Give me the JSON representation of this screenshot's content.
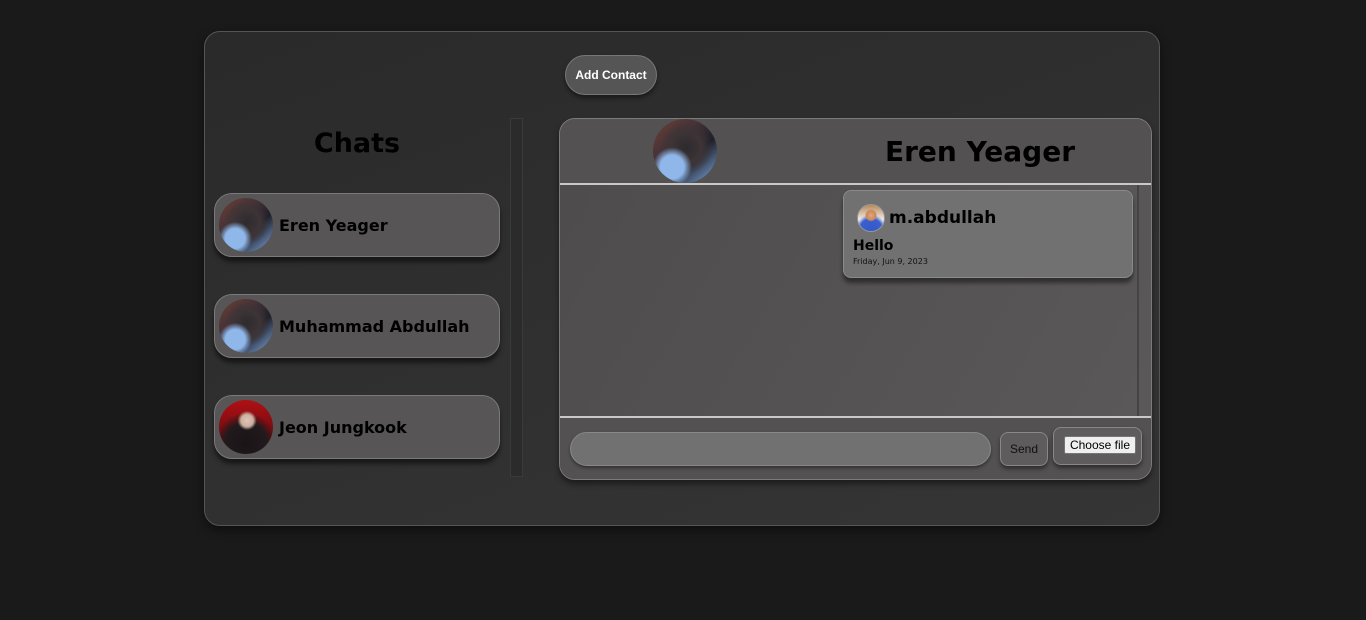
{
  "toolbar": {
    "add_contact_label": "Add Contact"
  },
  "sidebar": {
    "title": "Chats",
    "chats": [
      {
        "name": "Eren Yeager",
        "avatar": "eren-avatar"
      },
      {
        "name": "Muhammad Abdullah",
        "avatar": "eren-avatar"
      },
      {
        "name": "Jeon Jungkook",
        "avatar": "jungkook-avatar"
      }
    ]
  },
  "conversation": {
    "contact_name": "Eren Yeager",
    "messages": [
      {
        "sender": "m.abdullah",
        "text": "Hello",
        "timestamp": "Friday, Jun 9, 2023"
      }
    ]
  },
  "composer": {
    "input_value": "",
    "send_label": "Send",
    "file_label": "Choose file"
  }
}
